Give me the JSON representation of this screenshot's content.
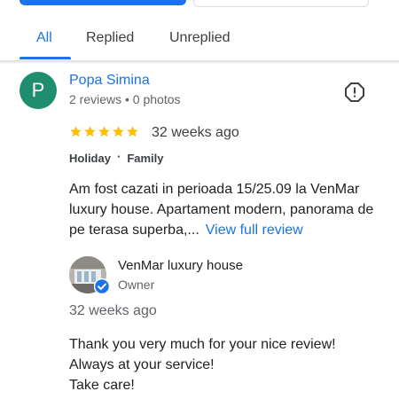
{
  "tabs": [
    {
      "label": "All",
      "active": true
    },
    {
      "label": "Replied",
      "active": false
    },
    {
      "label": "Unreplied",
      "active": false
    }
  ],
  "review": {
    "avatar_letter": "P",
    "avatar_color": "#1e8e6e",
    "reviewer_name": "Popa Simina",
    "reviewer_meta": "2 reviews • 0 photos",
    "rating": 5,
    "time_ago": "32 weeks ago",
    "tags": [
      "Holiday",
      "Family"
    ],
    "text": "Am fost cazati in perioada 15/25.09 la VenMar luxury house. Apartament modern, panorama de pe terasa superba,...",
    "view_full_label": "View full review",
    "report_icon": "report-flag-icon"
  },
  "reply": {
    "owner_name": "VenMar luxury house",
    "owner_role": "Owner",
    "time_ago": "32 weeks ago",
    "lines": [
      "Thank you very much for your nice review!",
      "Always at your service!",
      "Take care!"
    ]
  },
  "colors": {
    "accent": "#1a73e8",
    "star": "#fbbc04",
    "text_secondary": "#5f6368"
  }
}
